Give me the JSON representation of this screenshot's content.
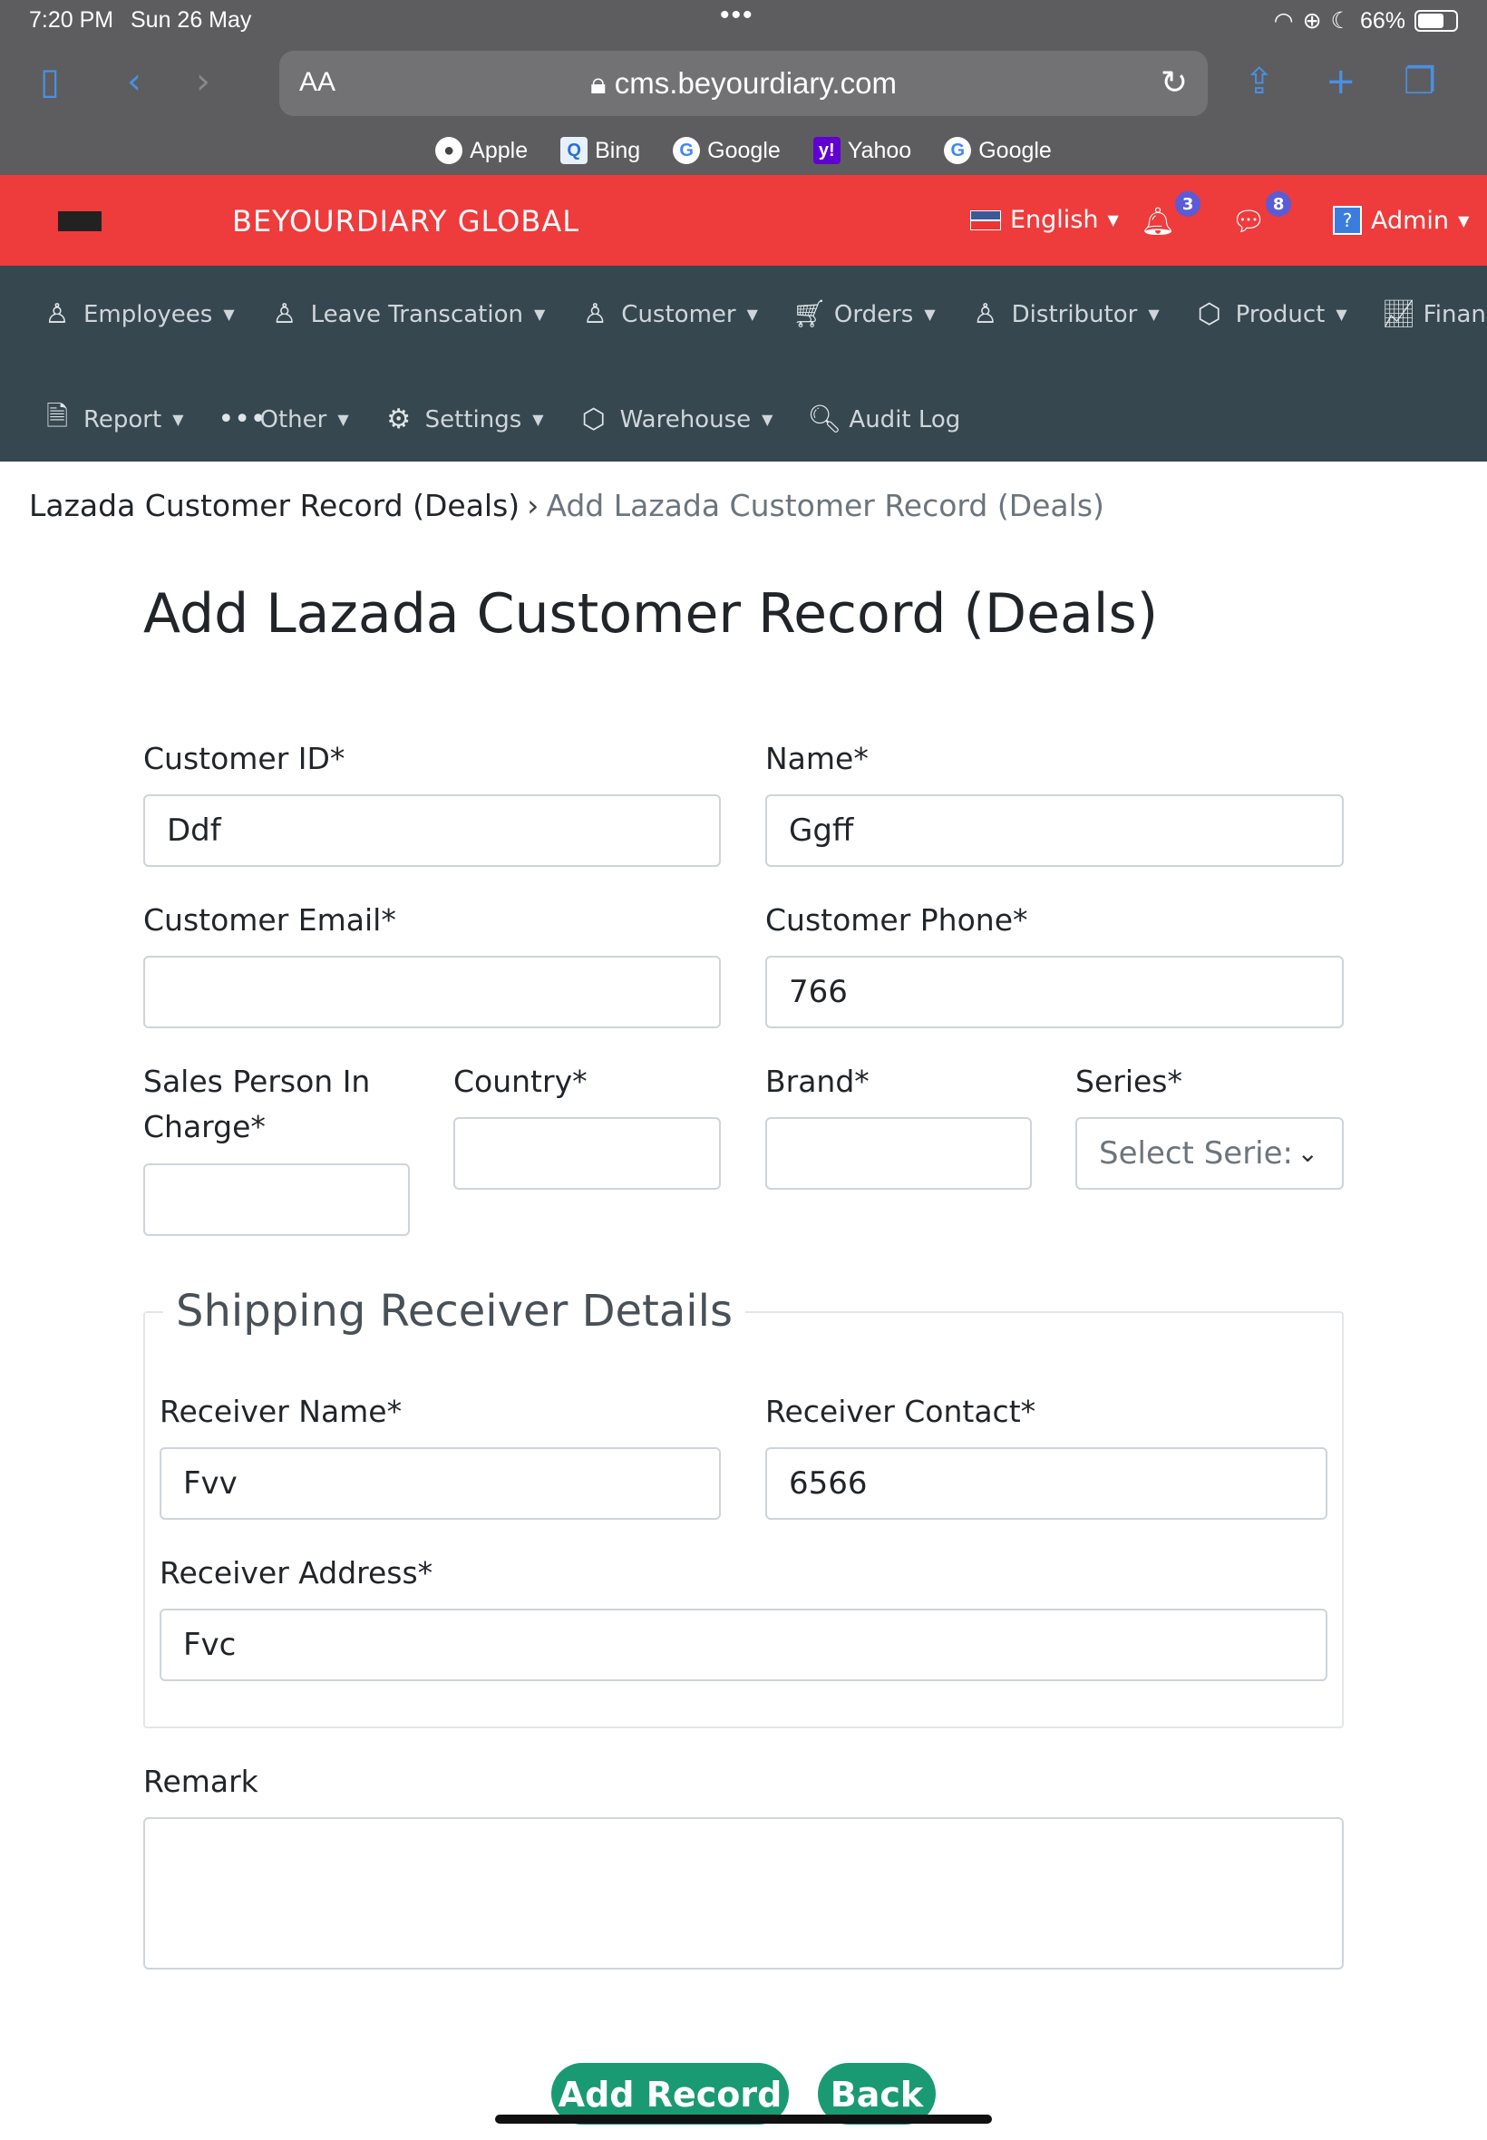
{
  "status_bar": {
    "time": "7:20 PM",
    "date": "Sun 26 May",
    "battery": "66%"
  },
  "browser": {
    "text_size_label": "AA",
    "url": "cms.beyourdiary.com",
    "favorites": [
      {
        "label": "Apple",
        "icon": "apple-icon"
      },
      {
        "label": "Bing",
        "icon": "bing-icon"
      },
      {
        "label": "Google",
        "icon": "google-icon"
      },
      {
        "label": "Yahoo",
        "icon": "yahoo-icon"
      },
      {
        "label": "Google",
        "icon": "google-icon"
      }
    ]
  },
  "header": {
    "brand": "BEYOURDIARY GLOBAL",
    "language": "English",
    "notifications_count": "3",
    "messages_count": "8",
    "user": "Admin",
    "accent_color": "#ee3b3c"
  },
  "nav": {
    "row1": [
      {
        "label": "Employees",
        "icon": "user-icon"
      },
      {
        "label": "Leave Transcation",
        "icon": "user-icon"
      },
      {
        "label": "Customer",
        "icon": "user-icon"
      },
      {
        "label": "Orders",
        "icon": "cart-icon"
      },
      {
        "label": "Distributor",
        "icon": "user-icon"
      },
      {
        "label": "Product",
        "icon": "box-icon"
      },
      {
        "label": "Finance",
        "icon": "chart-icon"
      }
    ],
    "row2": [
      {
        "label": "Report",
        "icon": "document-icon"
      },
      {
        "label": "Other",
        "icon": "more-icon"
      },
      {
        "label": "Settings",
        "icon": "gear-icon"
      },
      {
        "label": "Warehouse",
        "icon": "box-icon"
      },
      {
        "label": "Audit Log",
        "icon": "audit-icon"
      }
    ]
  },
  "breadcrumb": {
    "parent": "Lazada Customer Record (Deals)",
    "current": "Add Lazada Customer Record (Deals)"
  },
  "page_title": "Add Lazada Customer Record (Deals)",
  "form": {
    "customer_id": {
      "label": "Customer ID*",
      "value": "Ddf"
    },
    "name": {
      "label": "Name*",
      "value": "Ggff"
    },
    "customer_email": {
      "label": "Customer Email*",
      "value": ""
    },
    "customer_phone": {
      "label": "Customer Phone*",
      "value": "766"
    },
    "sales_person": {
      "label_line1": "Sales Person In",
      "label_line2": "Charge*",
      "value": ""
    },
    "country": {
      "label": "Country*",
      "value": ""
    },
    "brand": {
      "label": "Brand*",
      "value": ""
    },
    "series": {
      "label": "Series*",
      "placeholder": "Select Serie:"
    },
    "shipping": {
      "legend": "Shipping Receiver Details",
      "receiver_name": {
        "label": "Receiver Name*",
        "value": "Fvv"
      },
      "receiver_contact": {
        "label": "Receiver Contact*",
        "value": "6566"
      },
      "receiver_address": {
        "label": "Receiver Address*",
        "value": "Fvc"
      }
    },
    "remark": {
      "label": "Remark",
      "value": ""
    }
  },
  "buttons": {
    "add_record": "Add Record",
    "back": "Back",
    "color": "#1a9a73"
  }
}
